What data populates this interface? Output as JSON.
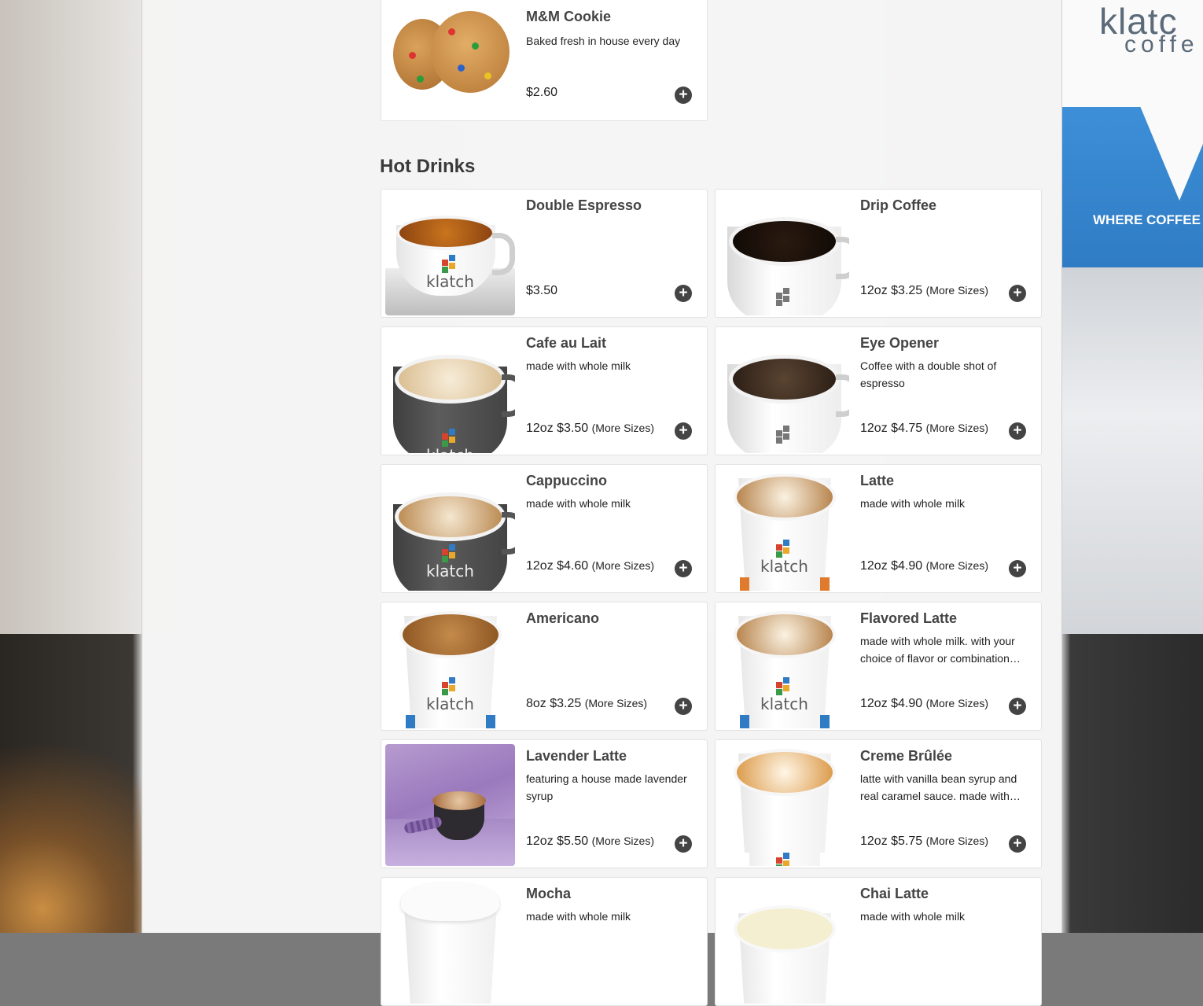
{
  "colors": {
    "panel_bg": "#f4f4f4",
    "card_bg": "#ffffff",
    "add_button": "#444444",
    "brand_blue": "#2f7cc4"
  },
  "background": {
    "cup_brand": "klatc",
    "cup_brand_sub": "coffe",
    "cup_tagline": "WHERE COFFEE IS THE C"
  },
  "top_item": {
    "name": "M&M Cookie",
    "description": "Baked fresh in house every day",
    "price": "$2.60",
    "more_sizes": "",
    "icon": "plus-circle-icon"
  },
  "section": {
    "title": "Hot Drinks"
  },
  "items": [
    {
      "name": "Double Espresso",
      "description": "",
      "price": "$3.50",
      "more_sizes": ""
    },
    {
      "name": "Drip Coffee",
      "description": "",
      "price": "12oz $3.25",
      "more_sizes": "(More Sizes)"
    },
    {
      "name": "Cafe au Lait",
      "description": "made with whole milk",
      "price": "12oz $3.50",
      "more_sizes": "(More Sizes)"
    },
    {
      "name": "Eye Opener",
      "description": "Coffee with a double shot of espresso",
      "price": "12oz $4.75",
      "more_sizes": "(More Sizes)"
    },
    {
      "name": "Cappuccino",
      "description": "made with whole milk",
      "price": "12oz $4.60",
      "more_sizes": "(More Sizes)"
    },
    {
      "name": "Latte",
      "description": "made with whole milk",
      "price": "12oz $4.90",
      "more_sizes": "(More Sizes)"
    },
    {
      "name": "Americano",
      "description": "",
      "price": "8oz $3.25",
      "more_sizes": "(More Sizes)"
    },
    {
      "name": "Flavored Latte",
      "description": "made with whole milk. with your choice of flavor or combination…",
      "price": "12oz $4.90",
      "more_sizes": "(More Sizes)"
    },
    {
      "name": "Lavender Latte",
      "description": "featuring a house made lavender syrup",
      "price": "12oz $5.50",
      "more_sizes": "(More Sizes)"
    },
    {
      "name": "Creme Brûlée",
      "description": "latte with vanilla bean syrup and real caramel sauce. made with…",
      "price": "12oz $5.75",
      "more_sizes": "(More Sizes)"
    },
    {
      "name": "Mocha",
      "description": "made with whole milk",
      "price": "",
      "more_sizes": ""
    },
    {
      "name": "Chai Latte",
      "description": "made with whole milk",
      "price": "",
      "more_sizes": ""
    }
  ],
  "logo_text": "klatch",
  "logo_sub": "coffee",
  "add_symbol": "+"
}
